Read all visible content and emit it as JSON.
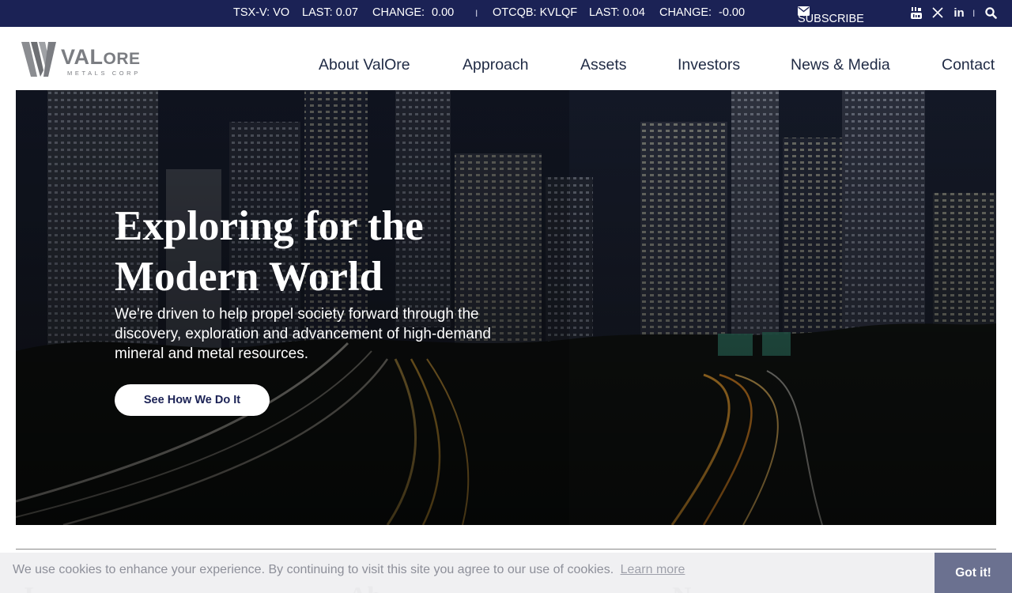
{
  "ticker": {
    "tsx_label": "TSX-V: VO",
    "tsx_last": "LAST: 0.07",
    "tsx_change_label": "CHANGE:",
    "tsx_change_value": "0.00",
    "separator": "I",
    "otc_label": "OTCQB: KVLQF",
    "otc_last": "LAST: 0.04",
    "otc_change_label": "CHANGE:",
    "otc_change_value": "-0.00"
  },
  "topbar": {
    "subscribe_label": "SUBSCRIBE",
    "linkedin_label": "in",
    "separator": "I",
    "icons": [
      "envelope-icon",
      "youtube-icon",
      "x-twitter-icon",
      "linkedin-icon",
      "search-icon"
    ]
  },
  "logo": {
    "word_main": "VAL",
    "word_small": "O",
    "word_end": "RE",
    "subline": "METALS CORP"
  },
  "nav": {
    "items": [
      "About ValOre",
      "Approach",
      "Assets",
      "Investors",
      "News & Media",
      "Contact"
    ]
  },
  "hero": {
    "title": "Exploring for the Modern World",
    "text": "We're driven to help propel society forward through the discovery, exploration and advancement of high-demand mineral and metal resources.",
    "button_label": "See How We Do It"
  },
  "below_fold": {
    "peek": [
      "I",
      "Ab",
      "N"
    ]
  },
  "cookie": {
    "text": "We use cookies to enhance your experience. By continuing to visit this site you agree to our use of cookies.",
    "link_label": "Learn more",
    "button_label": "Got it!"
  },
  "colors": {
    "topbar_bg": "#1b2255",
    "nav_text": "#1f2a44",
    "cookie_button": "#6b7190",
    "logo_gray": "#7b7d82"
  }
}
